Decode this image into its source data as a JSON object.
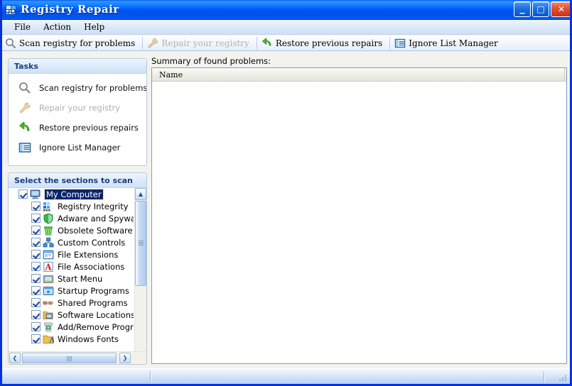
{
  "window": {
    "title": "Registry Repair",
    "icon": "registry-app-icon",
    "buttons": {
      "minimize": "_",
      "maximize": "□",
      "close": "✕"
    }
  },
  "menubar": {
    "items": [
      {
        "label": "File"
      },
      {
        "label": "Action"
      },
      {
        "label": "Help"
      }
    ]
  },
  "toolbar": {
    "buttons": [
      {
        "label": "Scan registry for problems",
        "icon": "magnifier-icon",
        "disabled": false
      },
      {
        "label": "Repair your registry",
        "icon": "wrench-icon",
        "disabled": true
      },
      {
        "label": "Restore previous repairs",
        "icon": "green-arrow-icon",
        "disabled": false
      },
      {
        "label": "Ignore List Manager",
        "icon": "list-icon",
        "disabled": false
      }
    ]
  },
  "tasks_panel": {
    "header": "Tasks",
    "items": [
      {
        "label": "Scan registry for problems",
        "icon": "magnifier-icon",
        "disabled": false
      },
      {
        "label": "Repair your registry",
        "icon": "wrench-icon",
        "disabled": true
      },
      {
        "label": "Restore previous repairs",
        "icon": "green-arrow-icon",
        "disabled": false
      },
      {
        "label": "Ignore List Manager",
        "icon": "list-icon",
        "disabled": false
      }
    ]
  },
  "sections_panel": {
    "header": "Select the sections to scan",
    "root": {
      "label": "My Computer",
      "icon": "computer-icon",
      "checked": true,
      "selected": true
    },
    "items": [
      {
        "label": "Registry Integrity",
        "icon": "registry-blocks-icon",
        "checked": true
      },
      {
        "label": "Adware and Spyware",
        "icon": "green-shield-icon",
        "checked": true
      },
      {
        "label": "Obsolete Software",
        "icon": "recycle-bin-icon",
        "checked": true
      },
      {
        "label": "Custom Controls",
        "icon": "nodes-icon",
        "checked": true
      },
      {
        "label": "File Extensions",
        "icon": "window-blue-icon",
        "checked": true
      },
      {
        "label": "File Associations",
        "icon": "red-a-icon",
        "checked": true
      },
      {
        "label": "Start Menu",
        "icon": "start-menu-icon",
        "checked": true
      },
      {
        "label": "Startup Programs",
        "icon": "startup-window-icon",
        "checked": true
      },
      {
        "label": "Shared Programs",
        "icon": "orange-plug-icon",
        "checked": true
      },
      {
        "label": "Software Locations",
        "icon": "folder-monitor-icon",
        "checked": true
      },
      {
        "label": "Add/Remove Programs",
        "icon": "green-recycle-icon",
        "checked": true
      },
      {
        "label": "Windows Fonts",
        "icon": "fonts-folder-icon",
        "checked": true
      }
    ],
    "scroll": {
      "up_arrow": "▲",
      "down_arrow": "▼",
      "left_arrow": "❮",
      "right_arrow": "❯"
    }
  },
  "main": {
    "summary_label": "Summary of found problems:",
    "columns": [
      "Name"
    ],
    "rows": []
  },
  "statusbar": {
    "panels": [
      "",
      "",
      ""
    ]
  },
  "colors": {
    "titlebar_blue": "#0058ee",
    "window_border": "#0831d9",
    "selection_blue": "#0a246a",
    "panel_header_text": "#1b3f7a"
  }
}
